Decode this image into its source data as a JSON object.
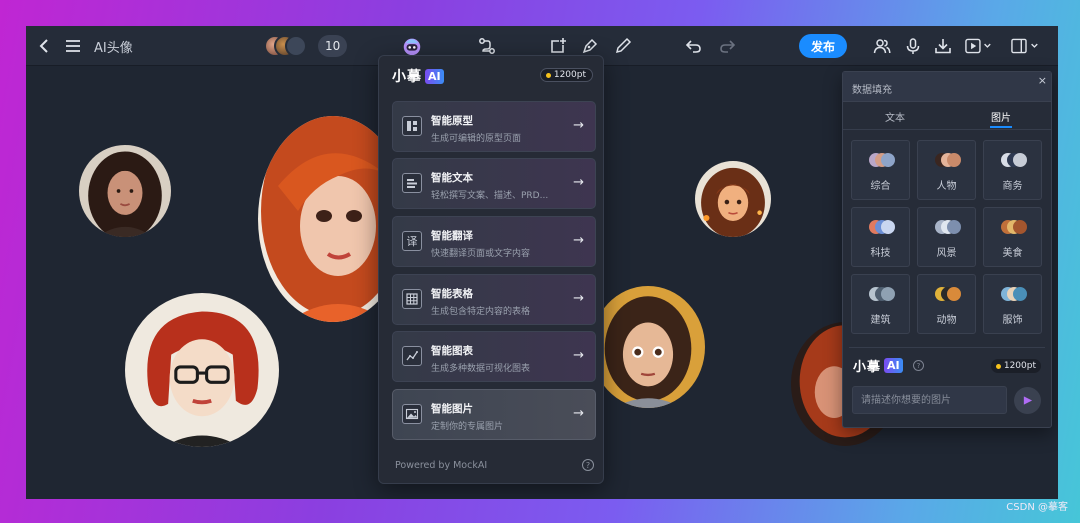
{
  "toolbar": {
    "title": "AI头像",
    "collaborator_count": "10",
    "publish_label": "发布",
    "icons": [
      "back-icon",
      "menu-icon",
      "ai-assistant-icon",
      "flow-icon",
      "add-frame-icon",
      "pen-icon",
      "pencil-icon",
      "undo-icon",
      "redo-icon",
      "people-icon",
      "mic-icon",
      "download-icon",
      "play-icon",
      "layout-icon"
    ]
  },
  "ai_panel": {
    "brand": "小摹",
    "badge": "AI",
    "points": "1200pt",
    "items": [
      {
        "title": "智能原型",
        "desc": "生成可编辑的原型页面",
        "icon": "prototype-icon"
      },
      {
        "title": "智能文本",
        "desc": "轻松撰写文案、描述、PRD...",
        "icon": "text-icon"
      },
      {
        "title": "智能翻译",
        "desc": "快速翻译页面或文字内容",
        "icon": "translate-icon"
      },
      {
        "title": "智能表格",
        "desc": "生成包含特定内容的表格",
        "icon": "table-icon"
      },
      {
        "title": "智能图表",
        "desc": "生成多种数据可视化图表",
        "icon": "chart-icon"
      },
      {
        "title": "智能图片",
        "desc": "定制你的专属图片",
        "icon": "image-icon"
      }
    ],
    "translate_glyph": "译",
    "arrow": "→",
    "powered_by": "Powered by MockAI",
    "help": "?"
  },
  "fill_panel": {
    "title": "数据填充",
    "close": "×",
    "tabs": [
      "文本",
      "图片"
    ],
    "active_tab": "图片",
    "categories": [
      "综合",
      "人物",
      "商务",
      "科技",
      "风景",
      "美食",
      "建筑",
      "动物",
      "服饰"
    ],
    "brand": "小摹",
    "badge": "AI",
    "help": "?",
    "points": "1200pt",
    "input_placeholder": "请描述你想要的图片"
  },
  "watermark": "CSDN @摹客",
  "colors": {
    "accent": "#1a8cff",
    "canvas": "#1f2632",
    "points_dot": "#f6c21c"
  }
}
